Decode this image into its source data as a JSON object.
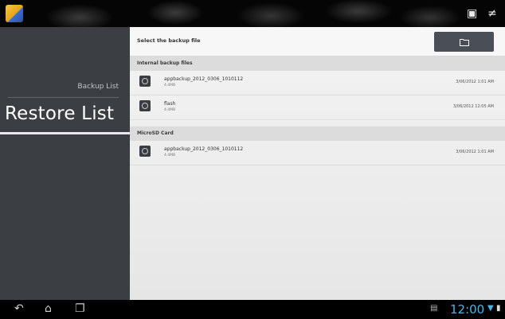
{
  "status_bar": {
    "icons": [
      "app-icon",
      "gallery-icon",
      "settings-icon"
    ]
  },
  "sidebar": {
    "items": [
      {
        "label": "Backup List",
        "active": false
      },
      {
        "label": "Restore List",
        "active": true
      }
    ]
  },
  "main": {
    "header_title": "Select the backup file",
    "folder_button_icon": "folder-icon",
    "sections": [
      {
        "title": "Internal backup files",
        "files": [
          {
            "name": "appbackup_2012_0306_1010112",
            "size": "4.4MB",
            "date": "3/06/2012 1:01 AM"
          },
          {
            "name": "flash",
            "size": "4.4MB",
            "date": "3/06/2012 12:05 AM"
          }
        ]
      },
      {
        "title": "MicroSD Card",
        "files": [
          {
            "name": "appbackup_2012_0306_1010112",
            "size": "4.4MB",
            "date": "3/06/2012 1:01 AM"
          }
        ]
      }
    ]
  },
  "system_bar": {
    "nav_icons": [
      "back-icon",
      "home-icon",
      "recent-apps-icon"
    ],
    "clock": "12:00",
    "status_icons": [
      "screenshot-icon",
      "wifi-icon",
      "battery-icon"
    ]
  },
  "colors": {
    "sidebar_bg": "#3b3e43",
    "content_bg": "#f3f3f3",
    "section_bg": "#dcdcdc",
    "folder_button_bg": "#4a4f57",
    "clock": "#46b7e8"
  }
}
